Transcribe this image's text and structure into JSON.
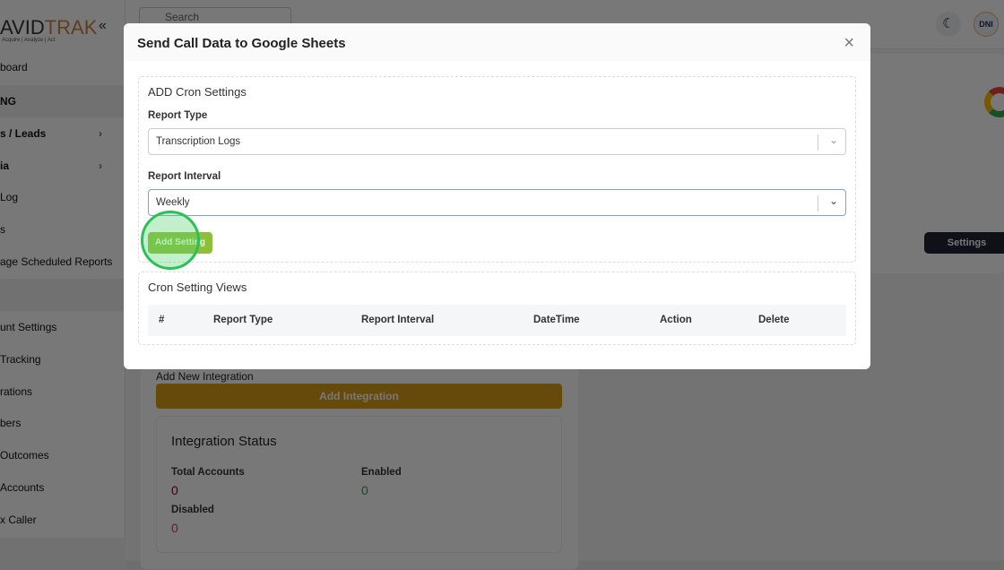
{
  "sidebar": {
    "logo_a": "AVID",
    "logo_b": "TRAK",
    "tagline": "Acquire | Analyze | Act",
    "collapse": "«",
    "items": [
      {
        "label": "board"
      },
      {
        "label": "NG"
      },
      {
        "label": "s / Leads"
      },
      {
        "label": "ia"
      },
      {
        "label": "Log"
      },
      {
        "label": "s"
      },
      {
        "label": "age Scheduled Reports"
      },
      {
        "label": ""
      },
      {
        "label": "unt Settings"
      },
      {
        "label": "Tracking"
      },
      {
        "label": "rations"
      },
      {
        "label": "bers"
      },
      {
        "label": "Outcomes"
      },
      {
        "label": "Accounts"
      },
      {
        "label": "x Caller"
      }
    ]
  },
  "topbar": {
    "search_placeholder": "Search",
    "avatar": "DNI"
  },
  "main": {
    "add_new_integration": "Add New Integration",
    "add_integration_button": "Add Integration",
    "integration_status": "Integration Status",
    "total_accounts_label": "Total Accounts",
    "total_accounts": "0",
    "enabled_label": "Enabled",
    "enabled": "0",
    "disabled_label": "Disabled",
    "disabled": "0",
    "settings_button": "Settings"
  },
  "modal": {
    "title": "Send Call Data to Google Sheets",
    "close": "×",
    "add_section": "ADD Cron Settings",
    "report_type_label": "Report Type",
    "report_type_value": "Transcription Logs",
    "report_interval_label": "Report Interval",
    "report_interval_value": "Weekly",
    "add_setting": "Add Setting",
    "views_section": "Cron Setting Views",
    "columns": [
      "#",
      "Report Type",
      "Report Interval",
      "DateTime",
      "Action",
      "Delete"
    ]
  },
  "colors": {
    "accent": "#f0a020",
    "dark": "#1f2133"
  }
}
